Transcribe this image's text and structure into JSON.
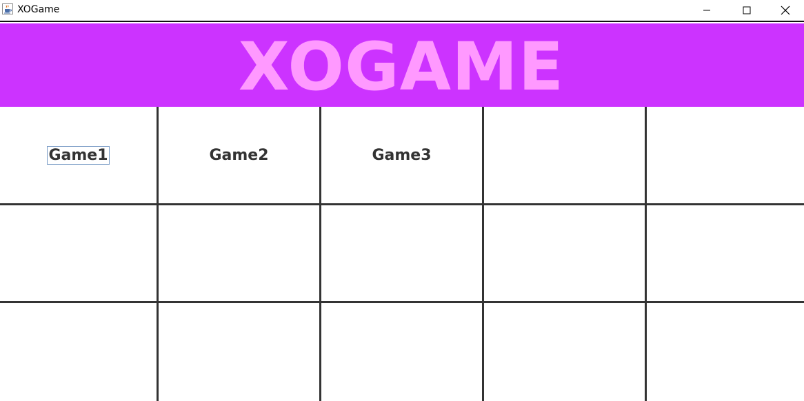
{
  "window": {
    "title": "XOGame",
    "app_icon": "java-cup-icon",
    "controls": [
      "minimize-icon",
      "maximize-icon",
      "close-icon"
    ]
  },
  "banner": {
    "title": "XOGAME",
    "background_color": "#cc33ff",
    "text_color": "#ff99ff"
  },
  "grid": {
    "rows": 3,
    "columns": 5,
    "line_color": "#333333",
    "cells": [
      [
        "Game1",
        "Game2",
        "Game3",
        "",
        ""
      ],
      [
        "",
        "",
        "",
        "",
        ""
      ],
      [
        "",
        "",
        "",
        "",
        ""
      ]
    ],
    "focused_cell": "Game1"
  }
}
